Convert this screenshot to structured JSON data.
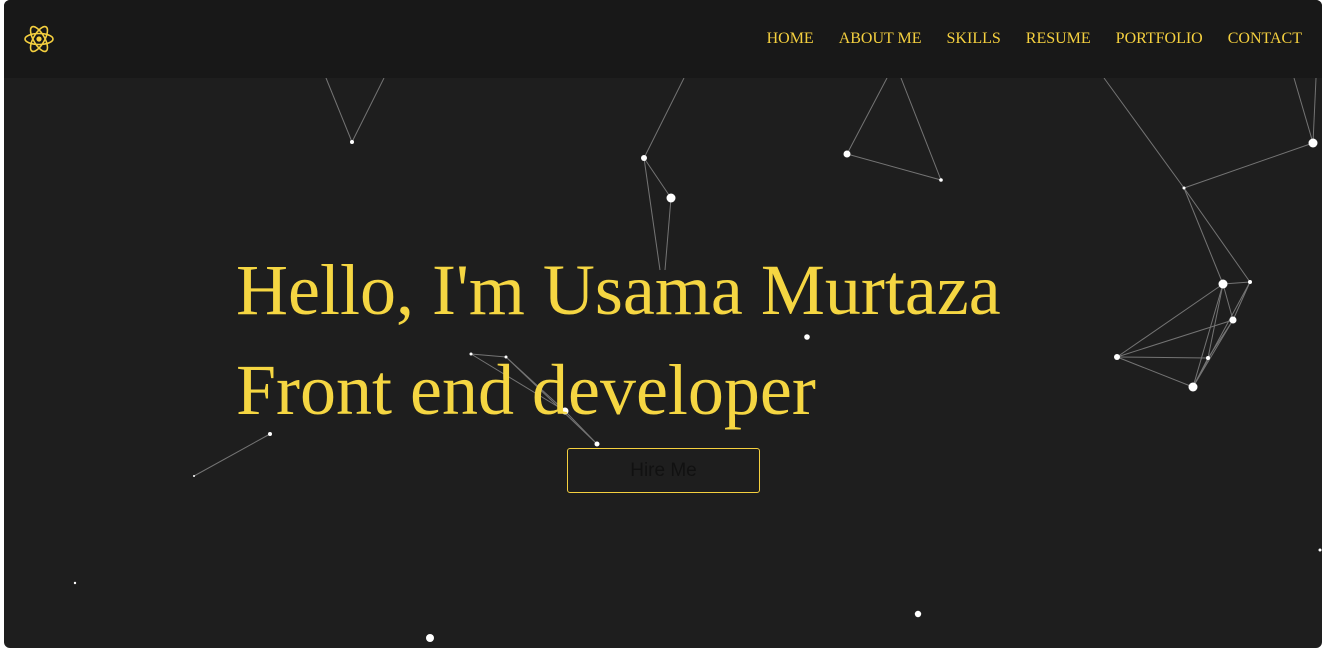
{
  "brand": {
    "logo_icon": "react-atom-icon",
    "color": "#f5d03f"
  },
  "nav": {
    "items": [
      {
        "label": "HOME"
      },
      {
        "label": "ABOUT ME"
      },
      {
        "label": "SKILLS"
      },
      {
        "label": "RESUME"
      },
      {
        "label": "PORTFOLIO"
      },
      {
        "label": "CONTACT"
      }
    ]
  },
  "hero": {
    "greeting": "Hello, I'm Usama Murtaza",
    "role": "Front end developer",
    "cta_label": "Hire Me"
  },
  "colors": {
    "background": "#1e1e1e",
    "navbar": "#181818",
    "accent": "#f5d03f",
    "particle": "#ffffff"
  }
}
